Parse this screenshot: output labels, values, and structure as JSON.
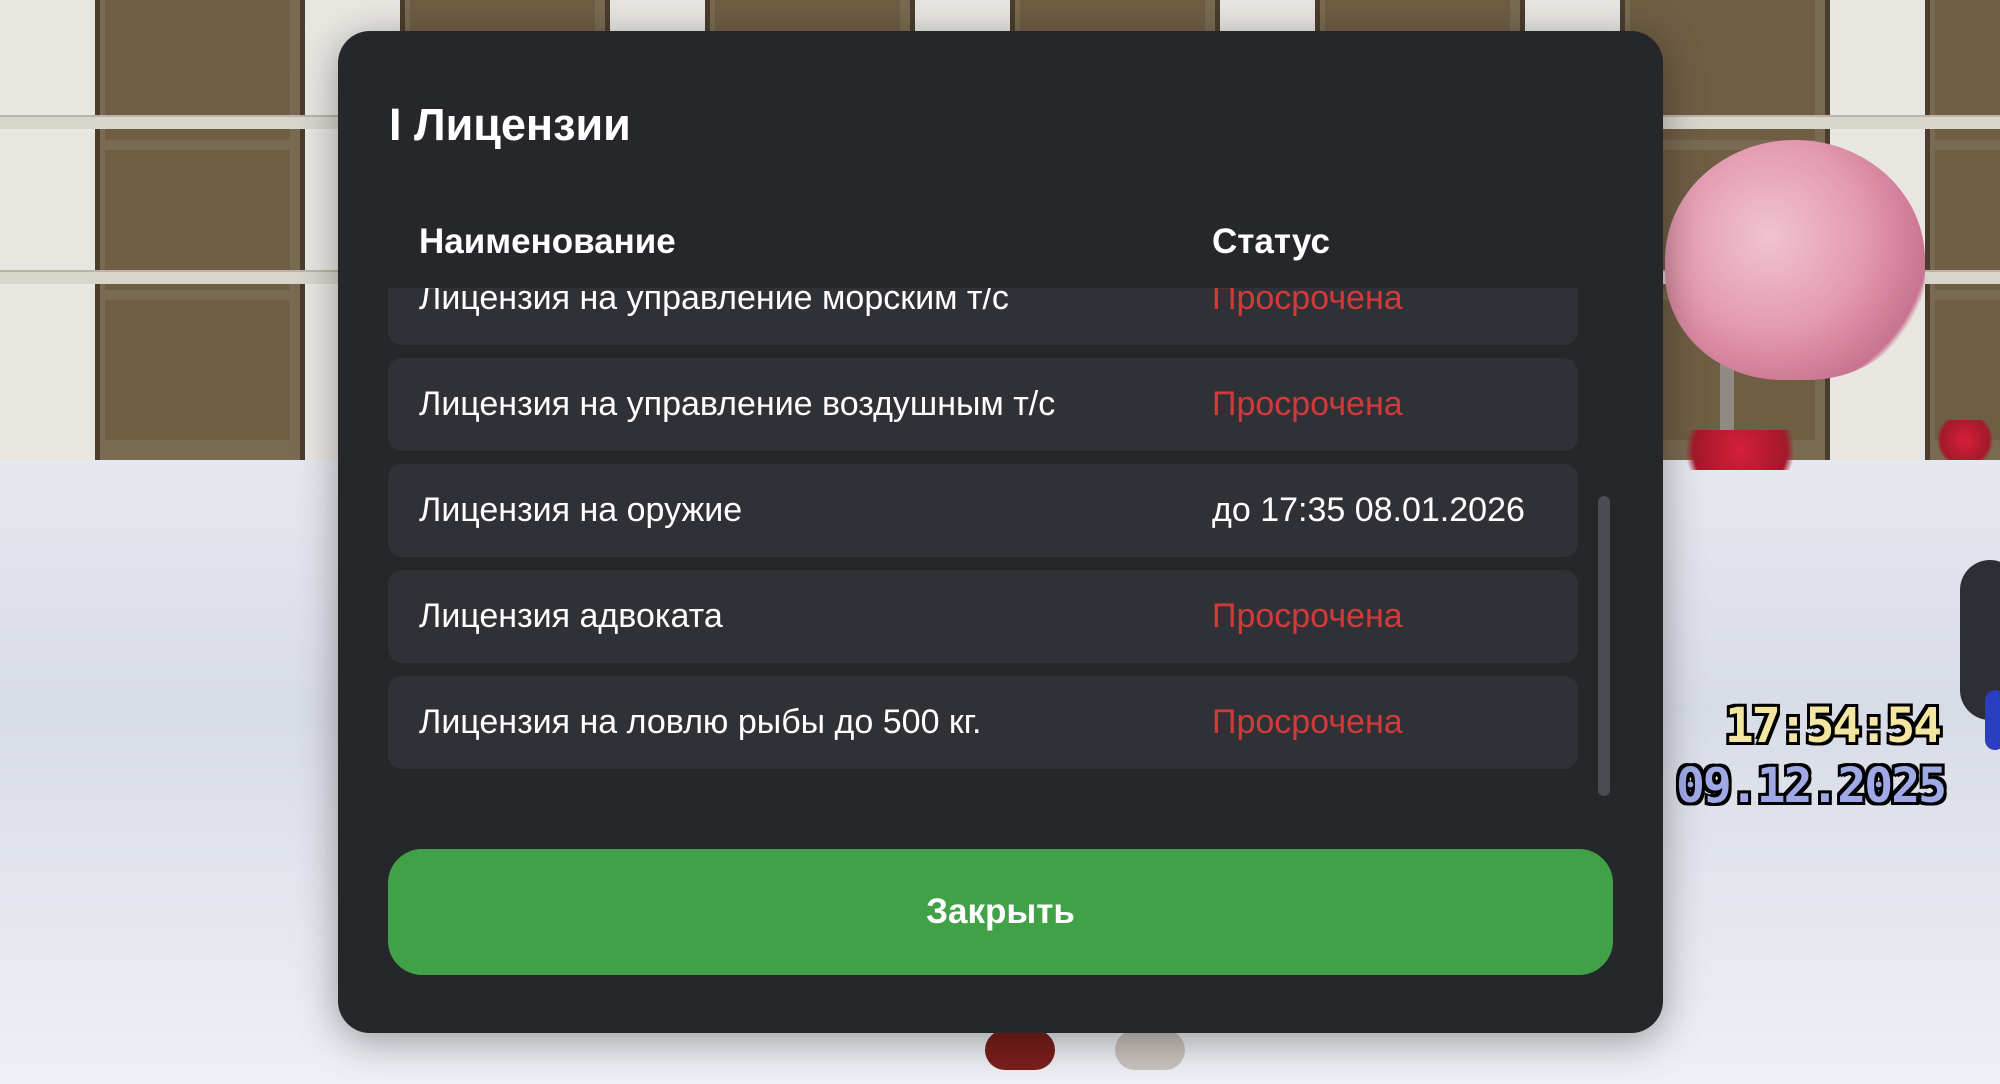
{
  "dialog": {
    "title": "I Лицензии",
    "columns": {
      "name": "Наименование",
      "status": "Статус"
    },
    "rows": [
      {
        "name": "Лицензия на управление морским т/с",
        "status": "Просрочена",
        "expired": true
      },
      {
        "name": "Лицензия на управление воздушным т/с",
        "status": "Просрочена",
        "expired": true
      },
      {
        "name": "Лицензия на оружие",
        "status": "до 17:35 08.01.2026",
        "expired": false
      },
      {
        "name": "Лицензия адвоката",
        "status": "Просрочена",
        "expired": true
      },
      {
        "name": "Лицензия на ловлю рыбы до 500 кг.",
        "status": "Просрочена",
        "expired": true
      }
    ],
    "close_label": "Закрыть"
  },
  "hud": {
    "time": "17:54:54",
    "date": "09.12.2025"
  },
  "colors": {
    "dialog_bg": "#26272b",
    "row_bg": "#303137",
    "expired_text": "#d23a3a",
    "close_button": "#41a147",
    "hud_time": "#f2e6a0",
    "hud_date": "#9fa9e6"
  }
}
